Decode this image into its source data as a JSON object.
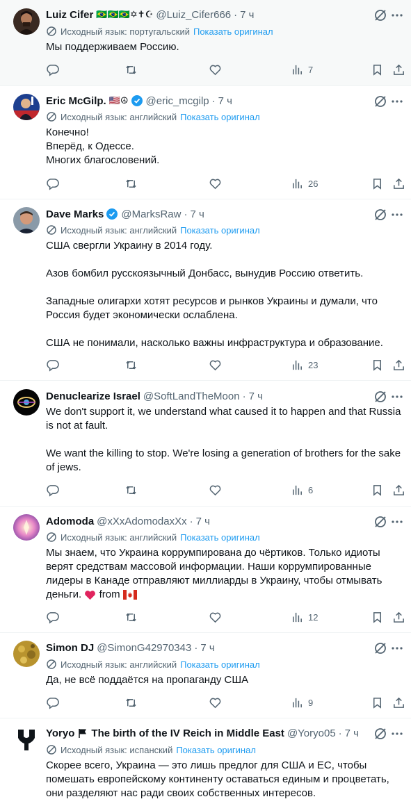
{
  "translate_label": "Исходный язык:",
  "show_original_label": "Показать оригинал",
  "separator": "·",
  "tweets": [
    {
      "name": "Luiz Cifer",
      "emoji": "🇧🇷🇧🇷🇧🇷✡✝☪",
      "handle": "@Luiz_Cifer666",
      "time": "7 ч",
      "lang": "португальский",
      "lines": [
        "Мы поддерживаем Россию."
      ],
      "views": "7"
    },
    {
      "name": "Eric McGilp.",
      "emoji": "🇺🇸☮",
      "handle": "@eric_mcgilp",
      "time": "7 ч",
      "lang": "английский",
      "lines": [
        "Конечно!",
        "Вперёд, к Одессе.",
        "Многих благословений."
      ],
      "views": "26"
    },
    {
      "name": "Dave Marks",
      "handle": "@MarksRaw",
      "time": "7 ч",
      "lang": "английский",
      "paragraphs": [
        "США свергли Украину в 2014 году.",
        "Азов бомбил русскоязычный Донбасс, вынудив Россию ответить.",
        "Западные олигархи хотят ресурсов и рынков Украины и думали, что Россия будет экономически ослаблена.",
        "США не понимали, насколько важны инфраструктура и образование."
      ],
      "views": "23"
    },
    {
      "name": "Denuclearize Israel",
      "handle": "@SoftLandTheMoon",
      "time": "7 ч",
      "paragraphs": [
        "We don't support it, we understand what caused it to happen and that Russia is not at fault.",
        "We want the killing to stop. We're losing a generation of brothers for the sake of jews."
      ],
      "views": "6"
    },
    {
      "name": "Adomoda",
      "handle": "@xXxAdomodaxXx",
      "time": "7 ч",
      "lang": "английский",
      "body": "Мы знаем, что Украина коррумпирована до чёртиков. Только идиоты верят средствам массовой информации. Наши коррумпированные лидеры в Канаде отправляют миллиарды в Украину, чтобы отмывать деньги.",
      "body_tail": "from",
      "views": "12"
    },
    {
      "name": "Simon DJ",
      "handle": "@SimonG42970343",
      "time": "7 ч",
      "lang": "английский",
      "lines": [
        "Да, не всё поддаётся на пропаганду США"
      ],
      "views": "9"
    },
    {
      "name": "Yoryo",
      "name_suffix": "The birth of the IV Reich in Middle East",
      "handle": "@Yoryo05",
      "time": "7 ч",
      "lang": "испанский",
      "body": "Скорее всего, Украина — это лишь предлог для США и ЕС, чтобы помешать европейскому континенту оставаться единым и процветать, они разделяют нас ради своих собственных интересов."
    }
  ]
}
